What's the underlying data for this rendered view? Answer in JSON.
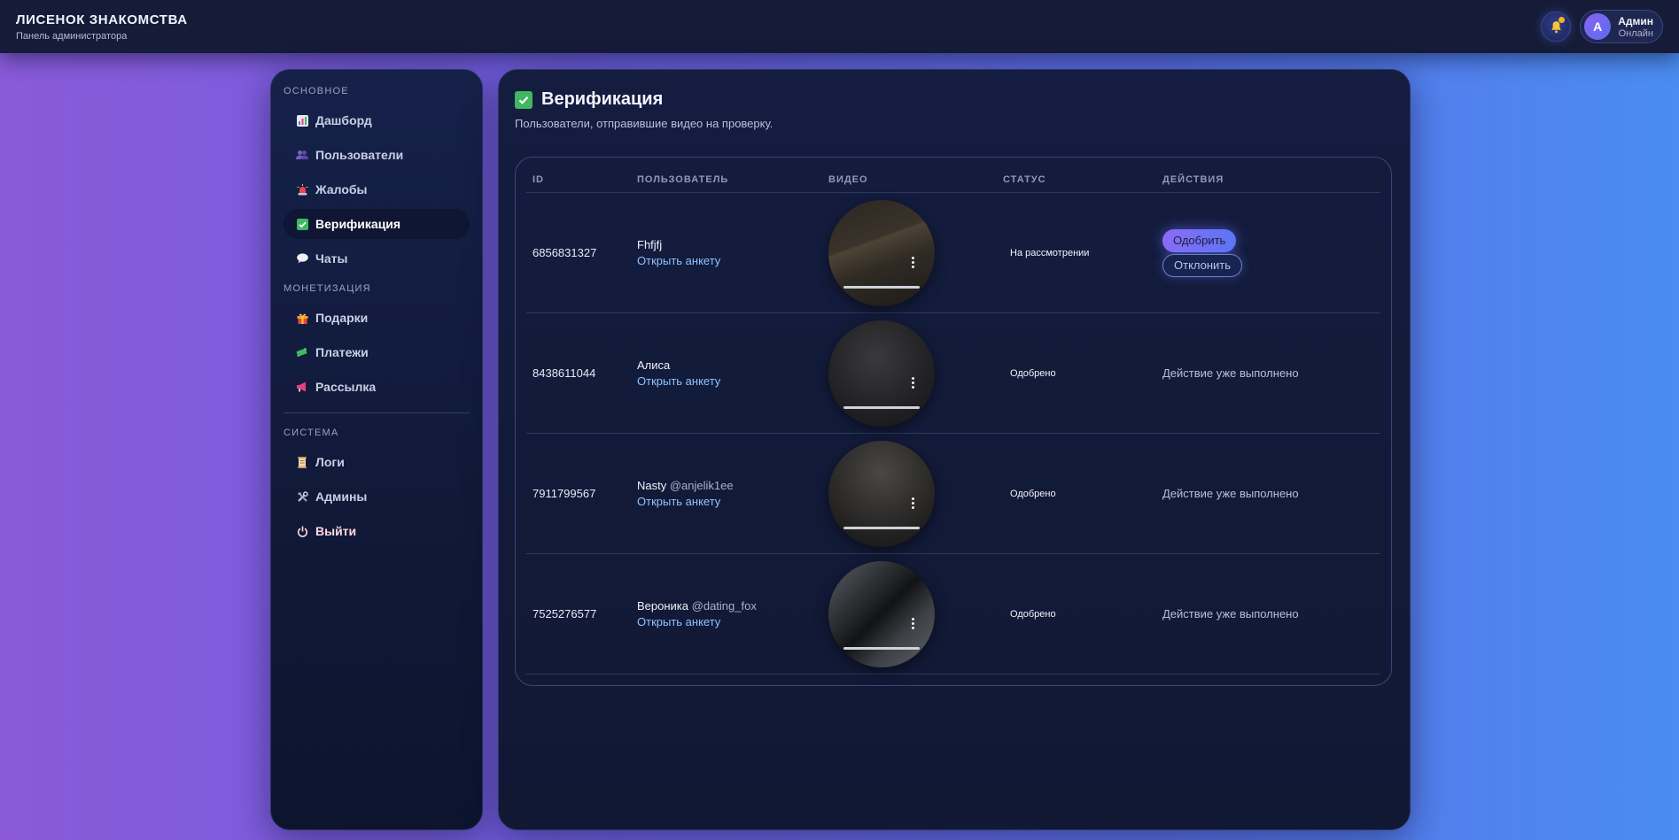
{
  "header": {
    "brand_title": "ЛИСЕНОК ЗНАКОМСТВА",
    "brand_subtitle": "Панель администратора",
    "user_avatar_letter": "A",
    "user_name": "Админ",
    "user_status": "Онлайн"
  },
  "sidebar": {
    "sections": [
      {
        "label": "ОСНОВНОЕ"
      },
      {
        "label": "МОНЕТИЗАЦИЯ"
      },
      {
        "label": "СИСТЕМА"
      }
    ],
    "items": [
      {
        "label": "Дашборд",
        "icon": "bar-chart-icon"
      },
      {
        "label": "Пользователи",
        "icon": "users-icon"
      },
      {
        "label": "Жалобы",
        "icon": "siren-icon"
      },
      {
        "label": "Верификация",
        "icon": "check-box-icon",
        "active": true
      },
      {
        "label": "Чаты",
        "icon": "speech-bubble-icon"
      },
      {
        "label": "Подарки",
        "icon": "gift-icon"
      },
      {
        "label": "Платежи",
        "icon": "money-icon"
      },
      {
        "label": "Рассылка",
        "icon": "megaphone-icon"
      },
      {
        "label": "Логи",
        "icon": "scroll-icon"
      },
      {
        "label": "Админы",
        "icon": "tools-icon"
      },
      {
        "label": "Выйти",
        "icon": "power-icon"
      }
    ]
  },
  "main": {
    "title": "Верификация",
    "subtitle": "Пользователи, отправившие видео на проверку.",
    "columns": [
      "ID",
      "ПОЛЬЗОВАТЕЛЬ",
      "ВИДЕО",
      "СТАТУС",
      "ДЕЙСТВИЯ"
    ],
    "rows": [
      {
        "id": "6856831327",
        "name": "Fhfjfj",
        "handle": "",
        "open_link": "Открыть анкету",
        "status": "На рассмотрении",
        "approve": "Одобрить",
        "reject": "Отклонить"
      },
      {
        "id": "8438611044",
        "name": "Алиса",
        "handle": "",
        "open_link": "Открыть анкету",
        "status": "Одобрено",
        "done": "Действие уже выполнено"
      },
      {
        "id": "7911799567",
        "name": "Nasty",
        "handle": "@anjelik1ee",
        "open_link": "Открыть анкету",
        "status": "Одобрено",
        "done": "Действие уже выполнено"
      },
      {
        "id": "7525276577",
        "name": "Вероника",
        "handle": "@dating_fox",
        "open_link": "Открыть анкету",
        "status": "Одобрено",
        "done": "Действие уже выполнено"
      }
    ]
  },
  "colors": {
    "accent": "#6f6cf4",
    "link": "#8fc2ff",
    "success": "#3fb860",
    "notification_dot": "#ffb020"
  }
}
